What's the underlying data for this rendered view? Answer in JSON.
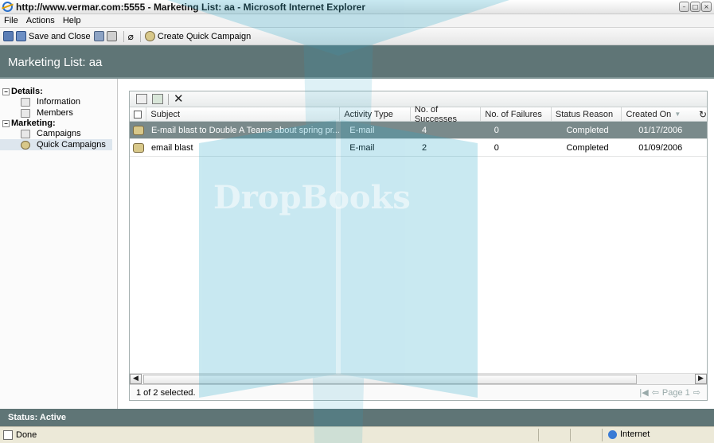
{
  "window": {
    "title": "http://www.vermar.com:5555 - Marketing List: aa - Microsoft Internet Explorer",
    "buttons": [
      "–",
      "□",
      "×"
    ]
  },
  "menu": [
    "File",
    "Actions",
    "Help"
  ],
  "toolbar": {
    "save_close": "Save and Close",
    "create_quick_campaign": "Create Quick Campaign"
  },
  "header": {
    "title": "Marketing List: aa"
  },
  "nav": {
    "details_label": "Details:",
    "details_items": [
      "Information",
      "Members"
    ],
    "marketing_label": "Marketing:",
    "marketing_items": [
      "Campaigns",
      "Quick Campaigns"
    ],
    "selected": "Quick Campaigns"
  },
  "grid": {
    "columns": {
      "subject": "Subject",
      "activity_type": "Activity Type",
      "successes": "No. of Successes",
      "failures": "No. of Failures",
      "status_reason": "Status Reason",
      "created_on": "Created On"
    },
    "rows": [
      {
        "subject": "E-mail blast to Double A Teams about spring pr...",
        "activity_type": "E-mail",
        "successes": "4",
        "failures": "0",
        "status_reason": "Completed",
        "created_on": "01/17/2006"
      },
      {
        "subject": "email blast",
        "activity_type": "E-mail",
        "successes": "2",
        "failures": "0",
        "status_reason": "Completed",
        "created_on": "01/09/2006"
      }
    ],
    "footer": "1 of 2 selected.",
    "page_label": "Page 1"
  },
  "status": {
    "label": "Status: Active"
  },
  "ie_status": {
    "done": "Done",
    "zone": "Internet"
  },
  "watermark": {
    "text": "DropBooks"
  },
  "colors": {
    "header_band": "#5f7576",
    "selected_row": "#7a8a8b",
    "watermark_blue": "#29a8c9"
  }
}
